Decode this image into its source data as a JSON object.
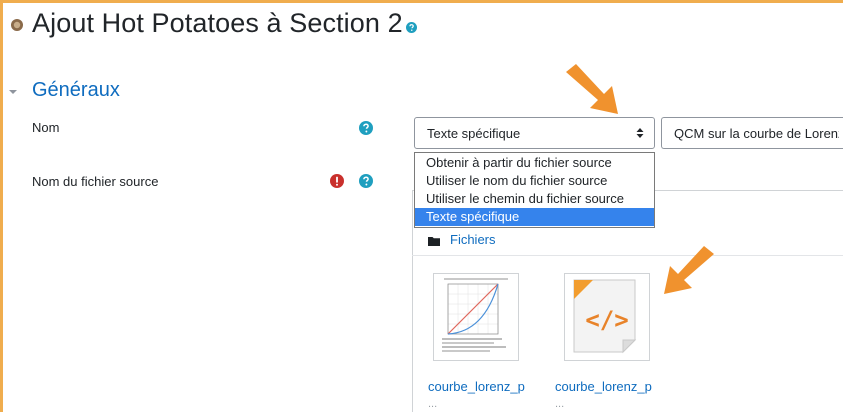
{
  "page": {
    "title": "Ajout Hot Potatoes à Section 2"
  },
  "section": {
    "title": "Généraux"
  },
  "form": {
    "nom_label": "Nom",
    "source_label": "Nom du fichier source",
    "select": {
      "selected": "Texte spécifique",
      "options": [
        "Obtenir à partir du fichier source",
        "Utiliser le nom du fichier source",
        "Utiliser le chemin du fichier source",
        "Texte spécifique"
      ]
    },
    "name_value": "QCM sur la courbe de Lorenz"
  },
  "filepicker": {
    "folder_label": "Fichiers",
    "files": [
      {
        "name": "courbe_lorenz_p",
        "subtitle": "...",
        "icon": "chart-thumbnail"
      },
      {
        "name": "courbe_lorenz_p",
        "subtitle": "...",
        "icon": "code-file-icon"
      }
    ]
  },
  "colors": {
    "accent_orange": "#f0922e",
    "link_blue": "#0f6cbf",
    "selected_option": "#3583ec",
    "help_icon": "#1f9fbf",
    "required_icon": "#c9302c"
  }
}
